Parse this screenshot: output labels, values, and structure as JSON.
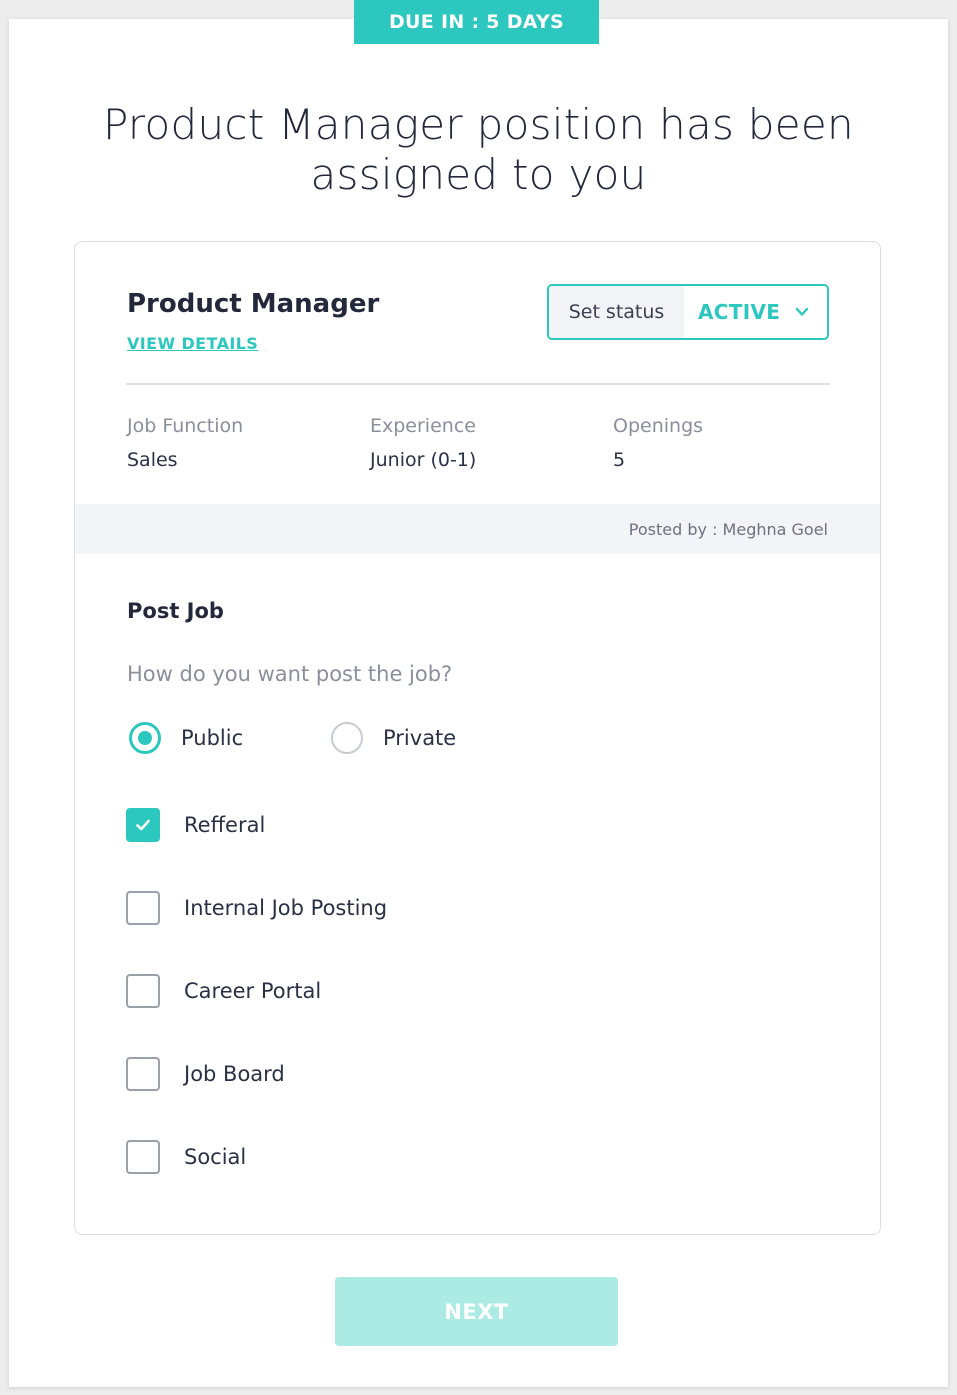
{
  "due_badge": "DUE IN : 5 DAYS",
  "headline": "Product Manager position has been assigned to you",
  "job": {
    "title": "Product Manager",
    "view_details": "VIEW DETAILS",
    "status_label": "Set status",
    "status_value": "ACTIVE",
    "meta": [
      {
        "label": "Job Function",
        "value": "Sales"
      },
      {
        "label": "Experience",
        "value": "Junior (0-1)"
      },
      {
        "label": "Openings",
        "value": "5"
      }
    ],
    "posted_by": "Posted by : Meghna Goel"
  },
  "post_job": {
    "title": "Post Job",
    "question": "How do you want post the job?",
    "visibility_options": [
      {
        "label": "Public",
        "selected": true
      },
      {
        "label": "Private",
        "selected": false
      }
    ],
    "channels": [
      {
        "label": "Refferal",
        "checked": true
      },
      {
        "label": "Internal Job Posting",
        "checked": false
      },
      {
        "label": "Career Portal",
        "checked": false
      },
      {
        "label": "Job Board",
        "checked": false
      },
      {
        "label": "Social",
        "checked": false
      }
    ]
  },
  "next_button": "NEXT",
  "colors": {
    "accent": "#2cc7be",
    "accent_disabled": "#abebe3",
    "band": "#f3f4f7"
  }
}
